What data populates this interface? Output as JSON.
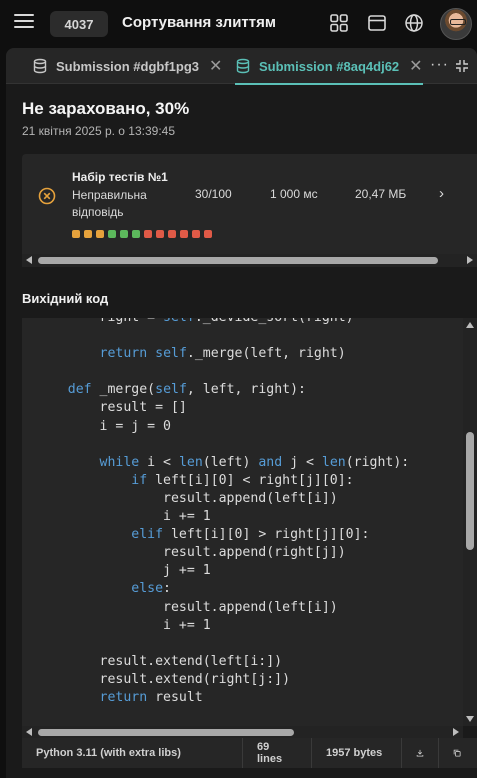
{
  "header": {
    "problem_number": "4037",
    "problem_title": "Сортування злиттям",
    "icons": [
      "menu-icon",
      "grid-icon",
      "window-icon",
      "globe-icon",
      "avatar"
    ]
  },
  "tabs": [
    {
      "label": "Submission #dgbf1pg3",
      "active": false,
      "icon": "database-icon"
    },
    {
      "label": "Submission #8aq4dj62",
      "active": true,
      "icon": "database-icon"
    }
  ],
  "tab_actions": {
    "more": "···"
  },
  "submission": {
    "status": "Не зараховано, 30%",
    "date": "21 квітня 2025 р. о 13:39:45"
  },
  "test_set": {
    "title": "Набір тестів №1",
    "verdict": "Неправильна відповідь",
    "score": "30/100",
    "time": "1 000 мс",
    "memory": "20,47 МБ",
    "arrow": "›",
    "test_results": [
      "warn",
      "warn",
      "warn",
      "ok",
      "ok",
      "ok",
      "fail",
      "fail",
      "fail",
      "fail",
      "fail",
      "fail"
    ],
    "colors": {
      "warn": "#e6a23c",
      "ok": "#5cb85c",
      "fail": "#e05a47",
      "error_icon": "#e6a23c"
    }
  },
  "source": {
    "label": "Вихідний код",
    "lines": [
      [
        [
          "",
          "        right = "
        ],
        [
          "kw",
          "self"
        ],
        [
          "",
          "._devide_sort(right)"
        ]
      ],
      [
        [
          "",
          ""
        ]
      ],
      [
        [
          "",
          "        "
        ],
        [
          "kw",
          "return"
        ],
        [
          "",
          " "
        ],
        [
          "kw",
          "self"
        ],
        [
          "",
          "._merge(left, right)"
        ]
      ],
      [
        [
          "",
          ""
        ]
      ],
      [
        [
          "",
          "    "
        ],
        [
          "kw",
          "def"
        ],
        [
          "",
          " _merge("
        ],
        [
          "kw",
          "self"
        ],
        [
          "",
          ", left, right):"
        ]
      ],
      [
        [
          "",
          "        result = []"
        ]
      ],
      [
        [
          "",
          "        i = j = 0"
        ]
      ],
      [
        [
          "",
          ""
        ]
      ],
      [
        [
          "",
          "        "
        ],
        [
          "kw",
          "while"
        ],
        [
          "",
          " i < "
        ],
        [
          "kw",
          "len"
        ],
        [
          "",
          "(left) "
        ],
        [
          "kw",
          "and"
        ],
        [
          "",
          " j < "
        ],
        [
          "kw",
          "len"
        ],
        [
          "",
          "(right):"
        ]
      ],
      [
        [
          "",
          "            "
        ],
        [
          "kw",
          "if"
        ],
        [
          "",
          " left[i][0] < right[j][0]:"
        ]
      ],
      [
        [
          "",
          "                result.append(left[i])"
        ]
      ],
      [
        [
          "",
          "                i += 1"
        ]
      ],
      [
        [
          "",
          "            "
        ],
        [
          "kw",
          "elif"
        ],
        [
          "",
          " left[i][0] > right[j][0]:"
        ]
      ],
      [
        [
          "",
          "                result.append(right[j])"
        ]
      ],
      [
        [
          "",
          "                j += 1"
        ]
      ],
      [
        [
          "",
          "            "
        ],
        [
          "kw",
          "else"
        ],
        [
          "",
          ":"
        ]
      ],
      [
        [
          "",
          "                result.append(left[i])"
        ]
      ],
      [
        [
          "",
          "                i += 1"
        ]
      ],
      [
        [
          "",
          ""
        ]
      ],
      [
        [
          "",
          "        result.extend(left[i:])"
        ]
      ],
      [
        [
          "",
          "        result.extend(right[j:])"
        ]
      ],
      [
        [
          "",
          "        "
        ],
        [
          "kw",
          "return"
        ],
        [
          "",
          " result"
        ]
      ]
    ]
  },
  "footer": {
    "language": "Python 3.11 (with extra libs)",
    "lines": "69 lines",
    "bytes": "1957 bytes"
  },
  "colors": {
    "accent": "#5bc0b7",
    "keyword": "#569cd6",
    "background": "#0f0f0f",
    "panel": "#1a1a1a"
  }
}
